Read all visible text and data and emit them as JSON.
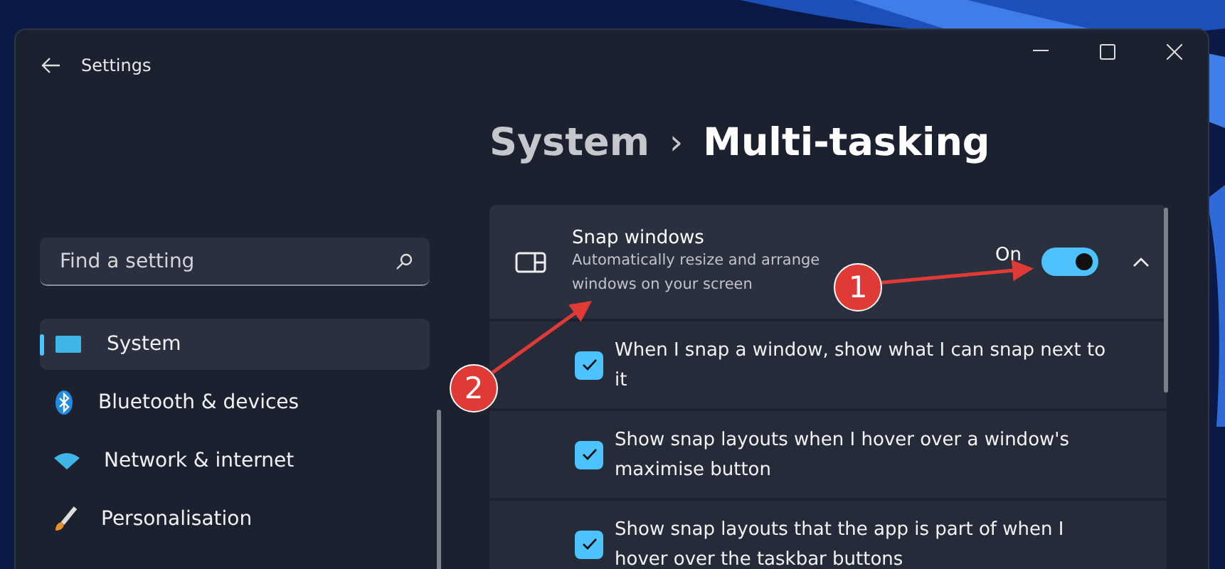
{
  "window": {
    "title": "Settings"
  },
  "search": {
    "placeholder": "Find a setting"
  },
  "nav": [
    {
      "label": "System",
      "selected": true
    },
    {
      "label": "Bluetooth & devices",
      "selected": false
    },
    {
      "label": "Network & internet",
      "selected": false
    },
    {
      "label": "Personalisation",
      "selected": false
    }
  ],
  "breadcrumb": {
    "parent": "System",
    "separator": "›",
    "current": "Multi-tasking"
  },
  "snap": {
    "title": "Snap windows",
    "description": "Automatically resize and arrange windows on your screen",
    "state_label": "On",
    "on": true,
    "expanded": true
  },
  "options": [
    {
      "label": "When I snap a window, show what I can snap next to it",
      "checked": true
    },
    {
      "label": "Show snap layouts when I hover over a window's maximise button",
      "checked": true
    },
    {
      "label": "Show snap layouts that the app is part of when I hover over the taskbar buttons",
      "checked": true
    }
  ],
  "annotations": [
    {
      "label": "1"
    },
    {
      "label": "2"
    }
  ]
}
